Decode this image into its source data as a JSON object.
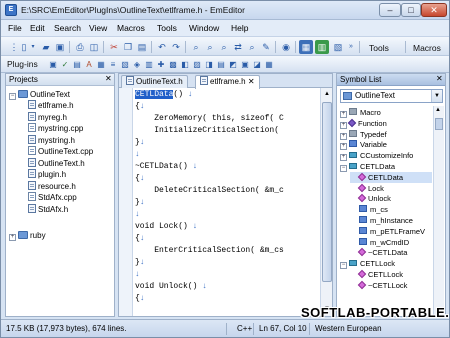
{
  "window": {
    "title": "E:\\SRC\\EmEditor\\PlugIns\\OutlineText\\etlframe.h - EmEditor",
    "minimize": "–",
    "maximize": "□",
    "close": "✕"
  },
  "menu": [
    "File",
    "Edit",
    "Search",
    "View",
    "Macros",
    "Tools",
    "Window",
    "Help"
  ],
  "toolbar": {
    "tools_label": "Tools",
    "macros_label": "Macros",
    "plugins_label": "Plug-ins"
  },
  "projects": {
    "title": "Projects",
    "close": "✕",
    "root": "OutlineText",
    "files": [
      "etlframe.h",
      "myreg.h",
      "mystring.cpp",
      "mystring.h",
      "OutlineText.cpp",
      "OutlineText.h",
      "plugin.h",
      "resource.h",
      "StdAfx.cpp",
      "StdAfx.h"
    ],
    "second_root": "ruby"
  },
  "editor": {
    "tabs": [
      "OutlineText.h",
      "etlframe.h"
    ],
    "lines": [
      {
        "pre": "",
        "hl": "CETLData",
        "post": "() ↓"
      },
      {
        "pre": "{↓",
        "hl": "",
        "post": ""
      },
      {
        "pre": "    ZeroMemory( this, sizeof( C",
        "hl": "",
        "post": ""
      },
      {
        "pre": "    InitializeCriticalSection(",
        "hl": "",
        "post": ""
      },
      {
        "pre": "}↓",
        "hl": "",
        "post": ""
      },
      {
        "pre": "↓",
        "hl": "",
        "post": ""
      },
      {
        "pre": "~CETLData() ↓",
        "hl": "",
        "post": ""
      },
      {
        "pre": "{↓",
        "hl": "",
        "post": ""
      },
      {
        "pre": "    DeleteCriticalSection( &m_c",
        "hl": "",
        "post": ""
      },
      {
        "pre": "}↓",
        "hl": "",
        "post": ""
      },
      {
        "pre": "↓",
        "hl": "",
        "post": ""
      },
      {
        "pre": "void Lock() ↓",
        "hl": "",
        "post": ""
      },
      {
        "pre": "{↓",
        "hl": "",
        "post": ""
      },
      {
        "pre": "    EnterCriticalSection( &m_cs",
        "hl": "",
        "post": ""
      },
      {
        "pre": "}↓",
        "hl": "",
        "post": ""
      },
      {
        "pre": "↓",
        "hl": "",
        "post": ""
      },
      {
        "pre": "void Unlock() ↓",
        "hl": "",
        "post": ""
      },
      {
        "pre": "{↓",
        "hl": "",
        "post": ""
      }
    ]
  },
  "symbols": {
    "title": "Symbol List",
    "close": "✕",
    "selected": "OutlineText",
    "items": [
      {
        "label": "Macro",
        "indent": 0,
        "icon": "gray",
        "exp": "+"
      },
      {
        "label": "Function",
        "indent": 0,
        "icon": "diamond",
        "exp": "+"
      },
      {
        "label": "Typedef",
        "indent": 0,
        "icon": "gray",
        "exp": "+"
      },
      {
        "label": "Variable",
        "indent": 0,
        "icon": "blue",
        "exp": "+"
      },
      {
        "label": "CCustomizeInfo",
        "indent": 0,
        "icon": "cyan",
        "exp": "+"
      },
      {
        "label": "CETLData",
        "indent": 0,
        "icon": "cyan",
        "exp": "−"
      },
      {
        "label": "CETLData",
        "indent": 1,
        "icon": "pink",
        "exp": "",
        "sel": true
      },
      {
        "label": "Lock",
        "indent": 1,
        "icon": "pink",
        "exp": ""
      },
      {
        "label": "Unlock",
        "indent": 1,
        "icon": "pink",
        "exp": ""
      },
      {
        "label": "m_cs",
        "indent": 1,
        "icon": "blue",
        "exp": ""
      },
      {
        "label": "m_hInstance",
        "indent": 1,
        "icon": "blue",
        "exp": ""
      },
      {
        "label": "m_pETLFrameV",
        "indent": 1,
        "icon": "blue",
        "exp": ""
      },
      {
        "label": "m_wCmdID",
        "indent": 1,
        "icon": "blue",
        "exp": ""
      },
      {
        "label": "~CETLData",
        "indent": 1,
        "icon": "pink",
        "exp": ""
      },
      {
        "label": "CETLLock",
        "indent": 0,
        "icon": "cyan",
        "exp": "−"
      },
      {
        "label": "CETLLock",
        "indent": 1,
        "icon": "pink",
        "exp": ""
      },
      {
        "label": "~CETLLock",
        "indent": 1,
        "icon": "pink",
        "exp": ""
      }
    ]
  },
  "status": {
    "size": "17.5 KB (17,973 bytes), 674 lines.",
    "mode": "C++",
    "position": "Ln 67, Col 10",
    "encoding": "Western European"
  },
  "watermark": "SOFTLAB-PORTABLE.RU"
}
